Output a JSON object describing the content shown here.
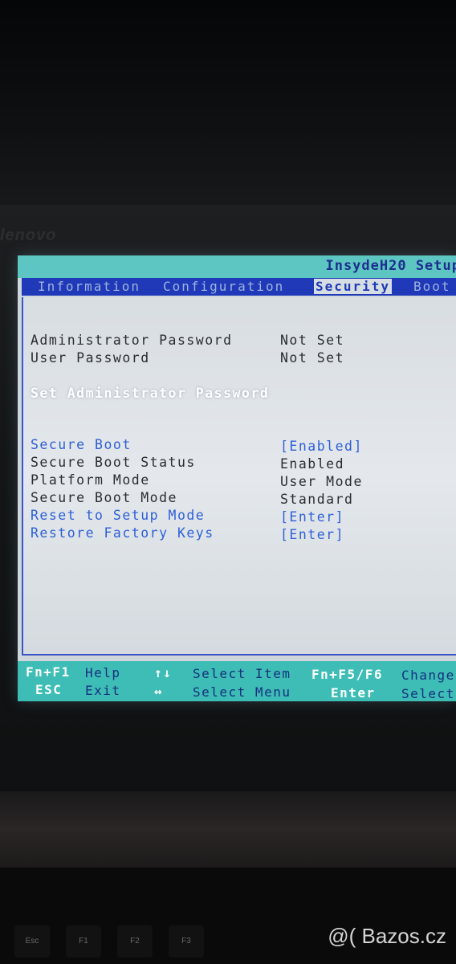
{
  "brand_text": "lenovo",
  "bios": {
    "title": "InsydeH20 Setup",
    "menu": [
      "Information",
      "Configuration",
      "Security",
      "Boot"
    ],
    "active_menu": "Security",
    "password_section": [
      {
        "label": "Administrator Password",
        "value": "Not Set"
      },
      {
        "label": "User Password",
        "value": "Not Set"
      }
    ],
    "selected_action": "Set Administrator Password",
    "secure_boot_section": [
      {
        "label": "Secure Boot",
        "value": "[Enabled]"
      },
      {
        "label": "Secure Boot Status",
        "value": "Enabled"
      },
      {
        "label": "Platform Mode",
        "value": "User Mode"
      },
      {
        "label": "Secure Boot Mode",
        "value": "Standard"
      },
      {
        "label": "Reset to Setup Mode",
        "value": "[Enter]"
      },
      {
        "label": "Restore Factory Keys",
        "value": "[Enter]"
      }
    ],
    "help": [
      {
        "key": "Fn+F1",
        "desc": "Help"
      },
      {
        "key": "ESC",
        "desc": "Exit"
      },
      {
        "key": "↑↓",
        "desc": "Select Item"
      },
      {
        "key": "↔",
        "desc": "Select Menu"
      },
      {
        "key": "Fn+F5/F6",
        "desc": "Change"
      },
      {
        "key": "Enter",
        "desc": "Select"
      }
    ]
  },
  "keyboard_keys": [
    "Esc",
    "F1",
    "F2",
    "F3"
  ],
  "watermark": "@( Bazos.cz"
}
